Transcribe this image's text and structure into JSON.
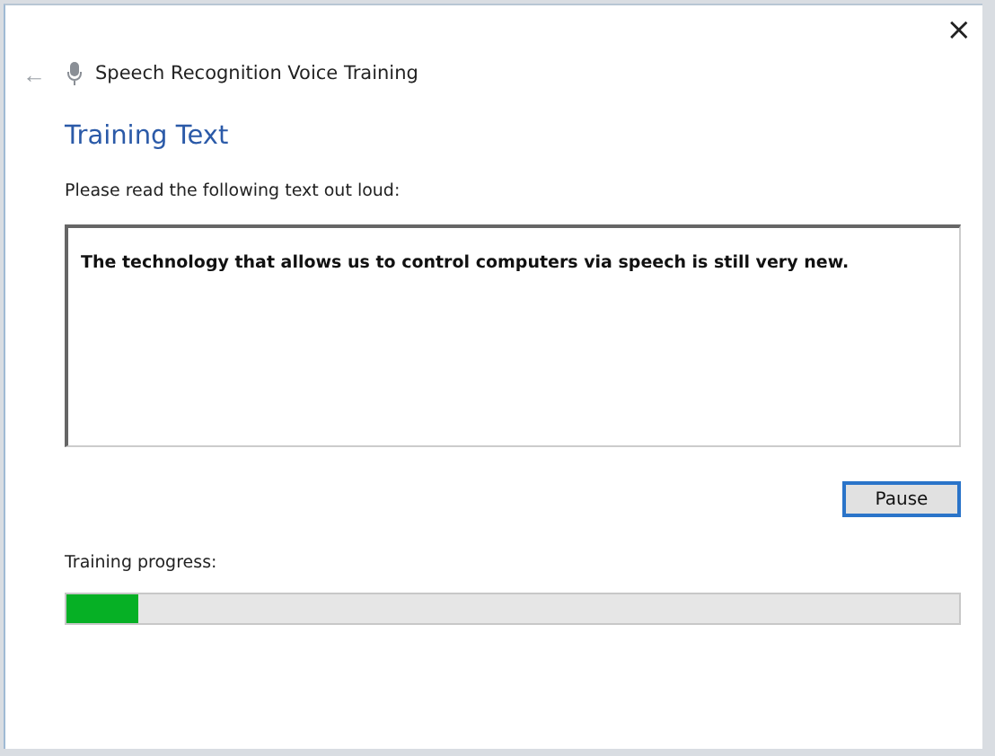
{
  "window": {
    "title": "Speech Recognition Voice Training",
    "close": "×",
    "back": "←"
  },
  "heading": "Training Text",
  "instruction": "Please read the following text out loud:",
  "training_text": "The technology that allows us to control computers via speech is still very new.",
  "buttons": [
    "Pause"
  ],
  "progress": {
    "label": "Training progress:",
    "level": 0.08
  }
}
